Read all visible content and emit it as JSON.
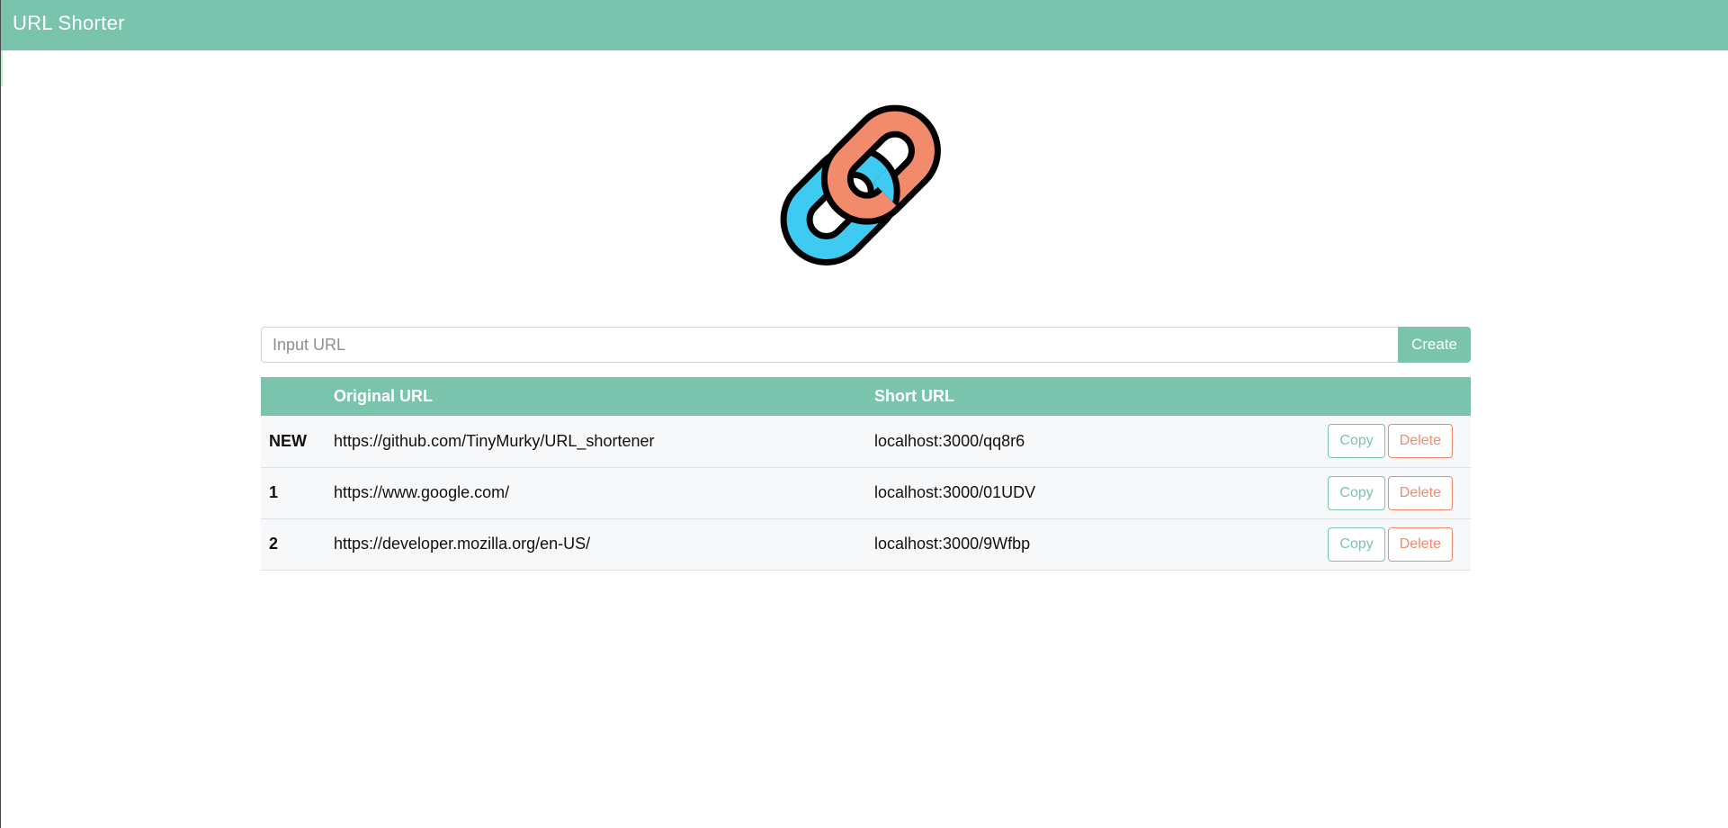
{
  "navbar": {
    "brand": "URL Shorter"
  },
  "logo": {
    "icon": "chain-link-icon",
    "colors": {
      "left_link": "#3fcbf1",
      "right_link": "#f28b6c",
      "outline": "#000000"
    }
  },
  "form": {
    "input_value": "",
    "input_placeholder": "Input URL",
    "create_label": "Create"
  },
  "table": {
    "headers": [
      "",
      "Original URL",
      "Short URL",
      ""
    ],
    "rows": [
      {
        "index": "NEW",
        "original": "https://github.com/TinyMurky/URL_shortener",
        "short": "localhost:3000/qq8r6",
        "copy_label": "Copy",
        "delete_label": "Delete"
      },
      {
        "index": "1",
        "original": "https://www.google.com/",
        "short": "localhost:3000/01UDV",
        "copy_label": "Copy",
        "delete_label": "Delete"
      },
      {
        "index": "2",
        "original": "https://developer.mozilla.org/en-US/",
        "short": "localhost:3000/9Wfbp",
        "copy_label": "Copy",
        "delete_label": "Delete"
      }
    ]
  },
  "colors": {
    "accent": "#7ac4ad",
    "danger": "#f08a6a",
    "row_background": "#f7f8f9"
  }
}
